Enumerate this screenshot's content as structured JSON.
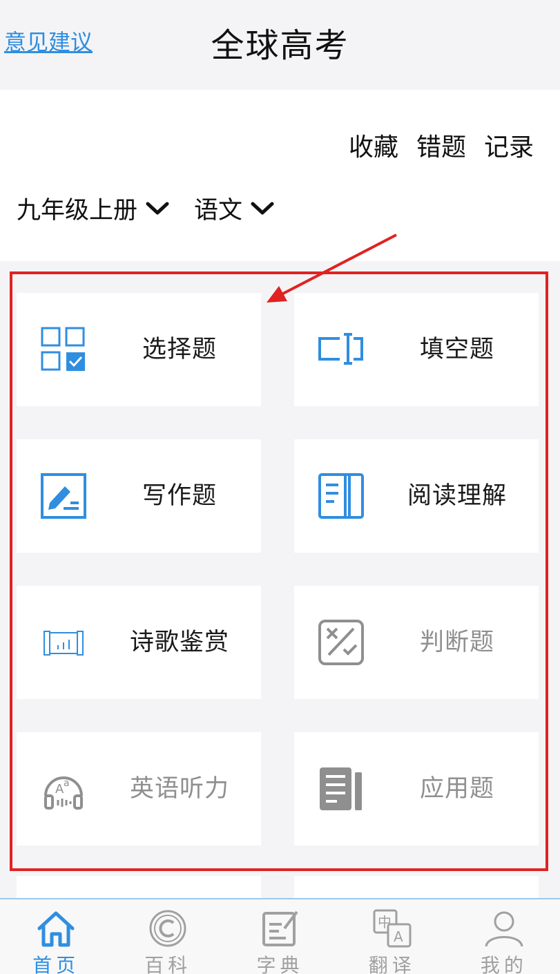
{
  "header": {
    "feedback_link": "意见建议",
    "title": "全球高考"
  },
  "quick_links": [
    "收藏",
    "错题",
    "记录"
  ],
  "filters": [
    {
      "label": "九年级上册",
      "icon": "chevron-down-icon"
    },
    {
      "label": "语文",
      "icon": "chevron-down-icon"
    }
  ],
  "categories": [
    {
      "label": "选择题",
      "icon": "multiple-choice-icon",
      "enabled": true
    },
    {
      "label": "填空题",
      "icon": "fill-blank-icon",
      "enabled": true
    },
    {
      "label": "写作题",
      "icon": "writing-icon",
      "enabled": true
    },
    {
      "label": "阅读理解",
      "icon": "reading-book-icon",
      "enabled": true
    },
    {
      "label": "诗歌鉴赏",
      "icon": "scroll-icon",
      "enabled": true
    },
    {
      "label": "判断题",
      "icon": "true-false-icon",
      "enabled": false
    },
    {
      "label": "英语听力",
      "icon": "headphones-icon",
      "enabled": false
    },
    {
      "label": "应用题",
      "icon": "document-icon",
      "enabled": false
    }
  ],
  "tabbar": [
    {
      "label": "首页",
      "icon": "home-icon",
      "active": true
    },
    {
      "label": "百科",
      "icon": "copyright-icon",
      "active": false
    },
    {
      "label": "字典",
      "icon": "edit-note-icon",
      "active": false
    },
    {
      "label": "翻译",
      "icon": "translate-icon",
      "active": false
    },
    {
      "label": "我的",
      "icon": "user-icon",
      "active": false
    }
  ],
  "colors": {
    "accent_blue": "#2f8ee0",
    "disabled_gray": "#8f8f8f",
    "highlight_red": "#e02222",
    "background": "#f4f4f6"
  }
}
